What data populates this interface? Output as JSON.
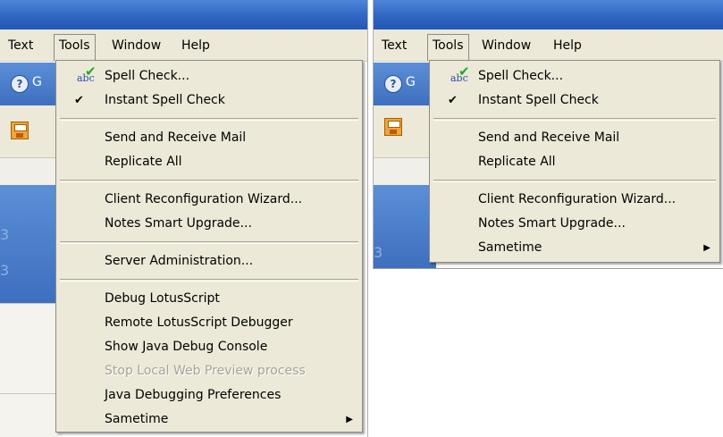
{
  "menubar": {
    "items": [
      "Text",
      "Tools",
      "Window",
      "Help"
    ]
  },
  "background": {
    "help_letter": "G"
  },
  "left_menu": {
    "items": [
      {
        "label": "Spell Check...",
        "icon": "spell-check-icon"
      },
      {
        "label": "Instant Spell Check",
        "checked": true
      },
      {
        "label": "Send and Receive Mail"
      },
      {
        "label": "Replicate All"
      },
      {
        "label": "Client Reconfiguration Wizard..."
      },
      {
        "label": "Notes Smart Upgrade..."
      },
      {
        "label": "Server Administration..."
      },
      {
        "label": "Debug LotusScript"
      },
      {
        "label": "Remote LotusScript Debugger"
      },
      {
        "label": "Show Java Debug Console"
      },
      {
        "label": "Stop Local Web Preview process",
        "disabled": true
      },
      {
        "label": "Java Debugging Preferences"
      },
      {
        "label": "Sametime",
        "submenu": true
      }
    ]
  },
  "right_menu": {
    "items": [
      {
        "label": "Spell Check...",
        "icon": "spell-check-icon"
      },
      {
        "label": "Instant Spell Check",
        "checked": true
      },
      {
        "label": "Send and Receive Mail"
      },
      {
        "label": "Replicate All"
      },
      {
        "label": "Client Reconfiguration Wizard..."
      },
      {
        "label": "Notes Smart Upgrade..."
      },
      {
        "label": "Sametime",
        "submenu": true
      }
    ]
  },
  "colors": {
    "menu_bg": "#ece9d8",
    "titlebar": "#2f66c4",
    "disabled_text": "#a6a39b"
  }
}
